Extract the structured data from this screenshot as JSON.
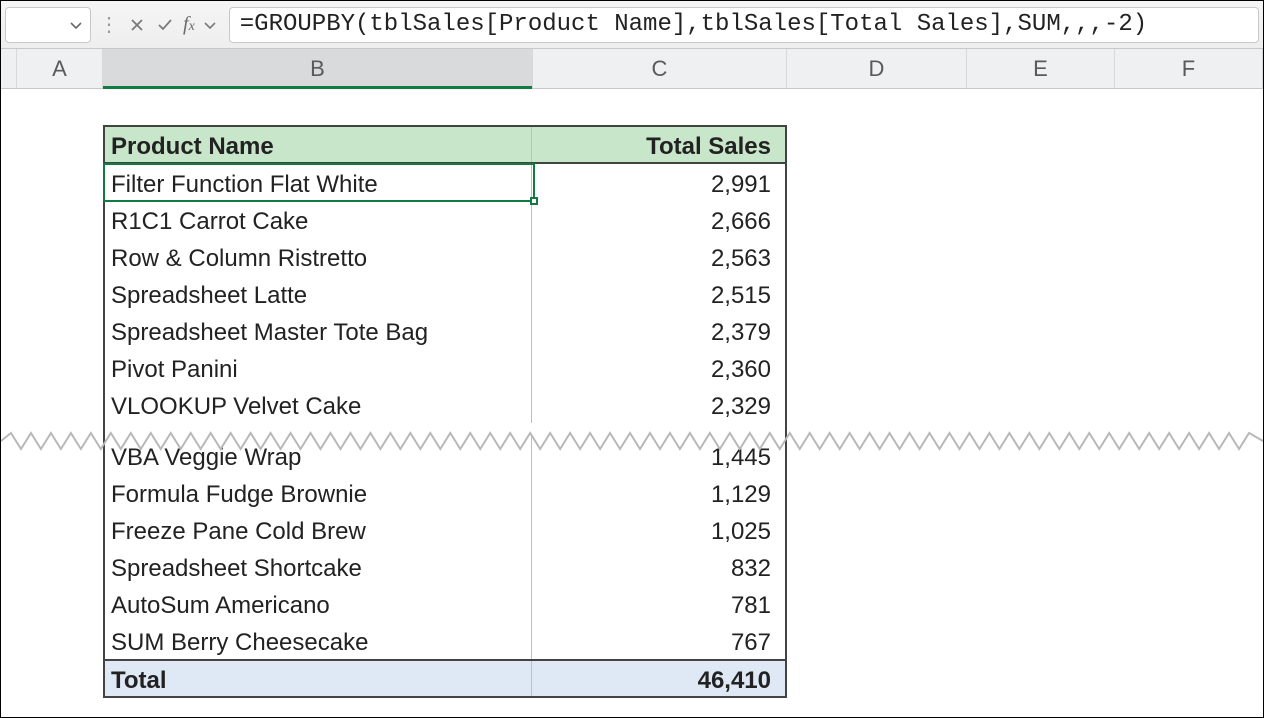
{
  "formula_bar": {
    "formula": "=GROUPBY(tblSales[Product Name],tblSales[Total Sales],SUM,,,-2)"
  },
  "columns": {
    "A": "A",
    "B": "B",
    "C": "C",
    "D": "D",
    "E": "E",
    "F": "F"
  },
  "table": {
    "headers": {
      "name": "Product Name",
      "value": "Total Sales"
    },
    "rows_top": [
      {
        "name": "Filter Function Flat White",
        "value": "2,991"
      },
      {
        "name": "R1C1 Carrot Cake",
        "value": "2,666"
      },
      {
        "name": "Row & Column Ristretto",
        "value": "2,563"
      },
      {
        "name": "Spreadsheet Latte",
        "value": "2,515"
      },
      {
        "name": "Spreadsheet Master Tote Bag",
        "value": "2,379"
      },
      {
        "name": "Pivot Panini",
        "value": "2,360"
      },
      {
        "name": "VLOOKUP Velvet Cake",
        "value": "2,329"
      }
    ],
    "rows_bottom": [
      {
        "name": "VBA Veggie Wrap",
        "value": "1,445"
      },
      {
        "name": "Formula Fudge Brownie",
        "value": "1,129"
      },
      {
        "name": "Freeze Pane Cold Brew",
        "value": "1,025"
      },
      {
        "name": "Spreadsheet Shortcake",
        "value": "832"
      },
      {
        "name": "AutoSum Americano",
        "value": "781"
      },
      {
        "name": "SUM Berry Cheesecake",
        "value": "767"
      }
    ],
    "total": {
      "label": "Total",
      "value": "46,410"
    }
  },
  "chart_data": {
    "type": "table",
    "title": "Product Name vs Total Sales (GROUPBY result, sorted desc, rows hidden between top and bottom sections)",
    "categories": [
      "Filter Function Flat White",
      "R1C1 Carrot Cake",
      "Row & Column Ristretto",
      "Spreadsheet Latte",
      "Spreadsheet Master Tote Bag",
      "Pivot Panini",
      "VLOOKUP Velvet Cake",
      "VBA Veggie Wrap",
      "Formula Fudge Brownie",
      "Freeze Pane Cold Brew",
      "Spreadsheet Shortcake",
      "AutoSum Americano",
      "SUM Berry Cheesecake"
    ],
    "values": [
      2991,
      2666,
      2563,
      2515,
      2379,
      2360,
      2329,
      1445,
      1129,
      1025,
      832,
      781,
      767
    ],
    "total": 46410
  }
}
